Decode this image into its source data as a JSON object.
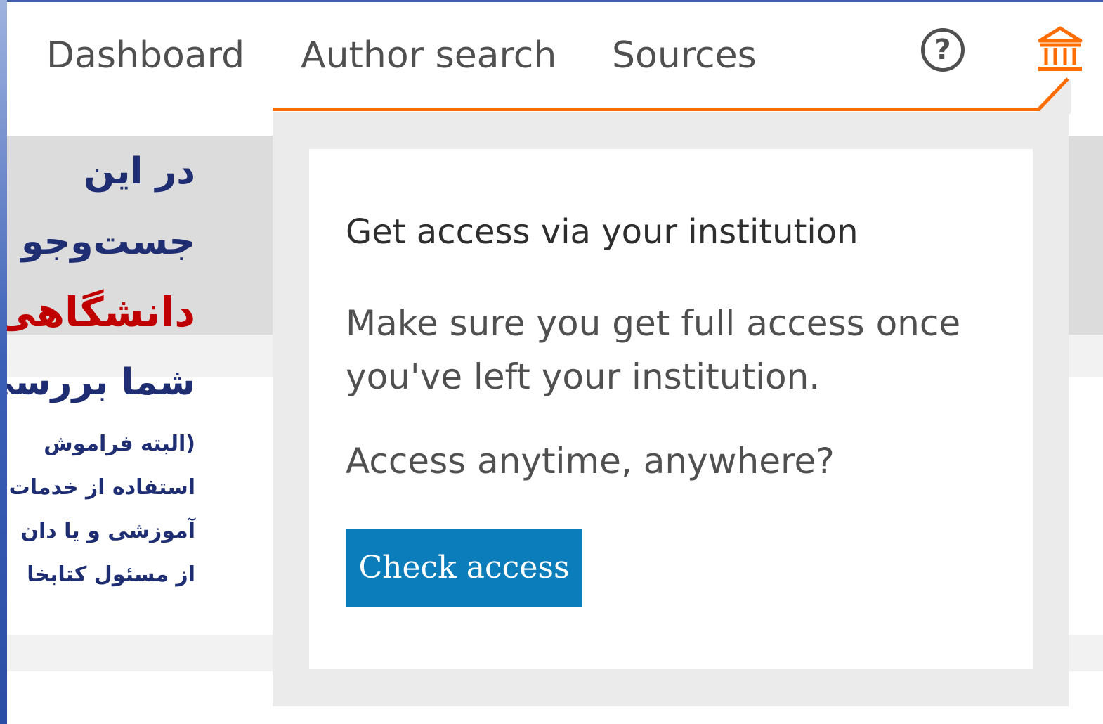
{
  "nav": {
    "dashboard": "Dashboard",
    "author_search": "Author search",
    "sources": "Sources",
    "help_icon_glyph": "?",
    "help_icon": "question-circle-icon",
    "institution_icon": "institution-building-icon"
  },
  "slide_text": {
    "line1": "در این",
    "line2": "جست‌وجو",
    "line3": "دانشگاهی",
    "line4": "شما بررسی",
    "line5": "(البته فراموش",
    "line6": "استفاده از خدمات",
    "line7": "آموزشی و یا دان",
    "line8": "از مسئول کتابخا"
  },
  "dropdown": {
    "title": "Get access via your institution",
    "description": "Make sure you get full access once you've left your institution.",
    "question": "Access anytime, anywhere?",
    "button_label": "Check access"
  },
  "colors": {
    "accent_orange": "#ff6c00",
    "button_blue": "#0c7dbb",
    "persian_blue": "#1f2e72",
    "persian_red": "#c00000"
  }
}
